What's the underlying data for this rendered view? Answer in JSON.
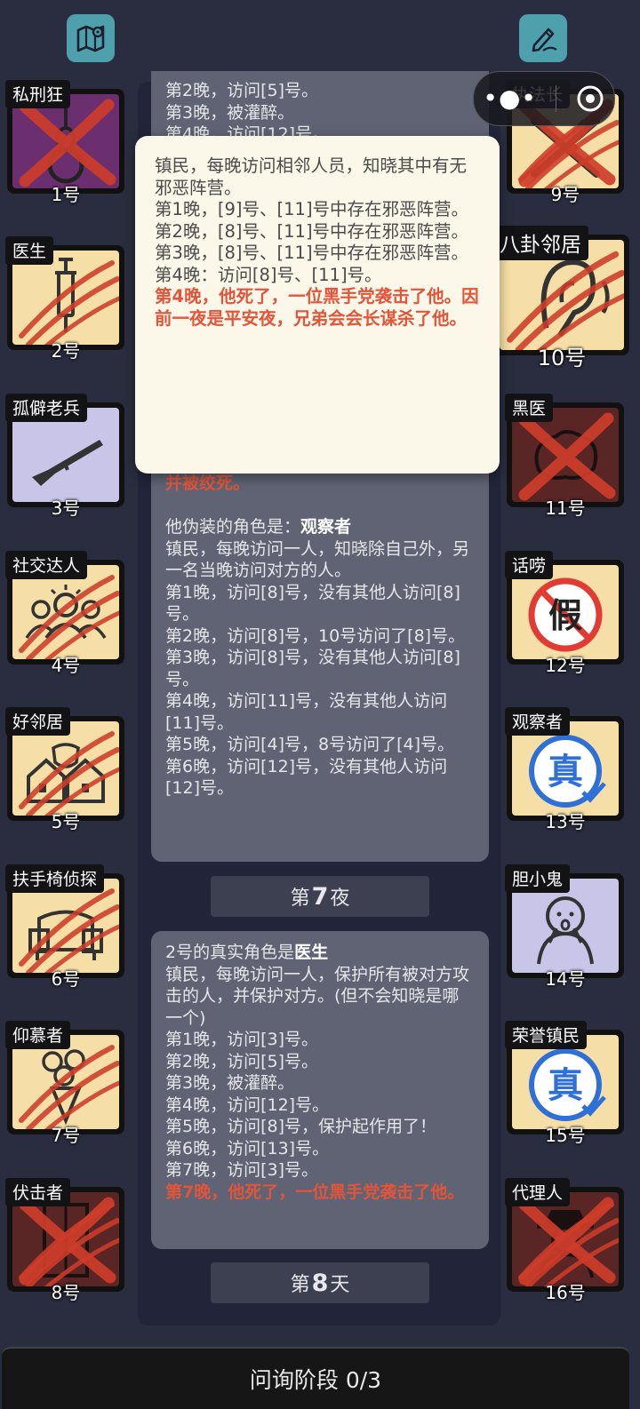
{
  "top_icons": {
    "map": "map-icon",
    "notes": "pencil-icon"
  },
  "players_left": [
    {
      "name": "私刑狂",
      "num": "1号",
      "bg": "darkpurple",
      "dead": true,
      "claw": false,
      "icon": "noose"
    },
    {
      "name": "医生",
      "num": "2号",
      "bg": "yellow",
      "dead": false,
      "claw": true,
      "icon": "syringe"
    },
    {
      "name": "孤僻老兵",
      "num": "3号",
      "bg": "purple",
      "dead": false,
      "claw": false,
      "icon": "rifle"
    },
    {
      "name": "社交达人",
      "num": "4号",
      "bg": "yellow",
      "dead": false,
      "claw": true,
      "icon": "people"
    },
    {
      "name": "好邻居",
      "num": "5号",
      "bg": "yellow",
      "dead": false,
      "claw": true,
      "icon": "houses"
    },
    {
      "name": "扶手椅侦探",
      "num": "6号",
      "bg": "yellow",
      "dead": false,
      "claw": true,
      "icon": "armchair"
    },
    {
      "name": "仰慕者",
      "num": "7号",
      "bg": "yellow",
      "dead": false,
      "claw": true,
      "icon": "bouquet"
    },
    {
      "name": "伏击者",
      "num": "8号",
      "bg": "darkred",
      "dead": true,
      "claw": true,
      "icon": "door"
    }
  ],
  "players_right": [
    {
      "name": "执法长",
      "num": "9号",
      "bg": "yellow",
      "dead": true,
      "claw": true,
      "icon": "batons"
    },
    {
      "name": "八卦邻居",
      "num": "10号",
      "bg": "yellow",
      "dead": false,
      "claw": true,
      "icon": "ear"
    },
    {
      "name": "黑医",
      "num": "11号",
      "bg": "darkred",
      "dead": true,
      "claw": false,
      "icon": "brain"
    },
    {
      "name": "话唠",
      "num": "12号",
      "bg": "yellow",
      "dead": false,
      "claw": false,
      "icon": "fake"
    },
    {
      "name": "观察者",
      "num": "13号",
      "bg": "yellow",
      "dead": false,
      "claw": false,
      "icon": "real"
    },
    {
      "name": "胆小鬼",
      "num": "14号",
      "bg": "purple",
      "dead": false,
      "claw": false,
      "icon": "scared"
    },
    {
      "name": "荣誉镇民",
      "num": "15号",
      "bg": "yellow",
      "dead": false,
      "claw": false,
      "icon": "real"
    },
    {
      "name": "代理人",
      "num": "16号",
      "bg": "darkred",
      "dead": true,
      "claw": true,
      "icon": "agent"
    }
  ],
  "log_top": [
    {
      "t": "第2晚，访问[5]号。"
    },
    {
      "t": "第3晚，被灌醉。"
    },
    {
      "t": "第4晚，访问[12]号。"
    }
  ],
  "log_card1": [
    {
      "t": "并被绞死。",
      "red": true
    },
    {
      "t": " "
    },
    {
      "t": "他伪装的角色是：",
      "b": "观察者"
    },
    {
      "t": "镇民，每晚访问一人，知晓除自己外，另一名当晚访问对方的人。"
    },
    {
      "t": "第1晚，访问[8]号，没有其他人访问[8]号。"
    },
    {
      "t": "第2晚，访问[8]号，10号访问了[8]号。"
    },
    {
      "t": "第3晚，访问[8]号，没有其他人访问[8]号。"
    },
    {
      "t": "第4晚，访问[11]号，没有其他人访问[11]号。"
    },
    {
      "t": "第5晚，访问[4]号，8号访问了[4]号。"
    },
    {
      "t": "第6晚，访问[12]号，没有其他人访问[12]号。"
    }
  ],
  "night7": {
    "prefix": "第",
    "num": "7",
    "suffix": "夜"
  },
  "log_card2": [
    {
      "t": "2号的真实角色是",
      "b": "医生"
    },
    {
      "t": "镇民，每晚访问一人，保护所有被对方攻击的人，并保护对方。(但不会知晓是哪一个)"
    },
    {
      "t": "第1晚，访问[3]号。"
    },
    {
      "t": "第2晚，访问[5]号。"
    },
    {
      "t": "第3晚，被灌醉。"
    },
    {
      "t": "第4晚，访问[12]号。"
    },
    {
      "t": "第5晚，访问[8]号，保护起作用了！"
    },
    {
      "t": "第6晚，访问[13]号。"
    },
    {
      "t": "第7晚，访问[3]号。"
    },
    {
      "t": "第7晚，他死了，一位黑手党袭击了他。",
      "red": true
    }
  ],
  "day8": {
    "prefix": "第",
    "num": "8",
    "suffix": "天"
  },
  "tooltip": [
    {
      "t": "镇民，每晚访问相邻人员，知晓其中有无邪恶阵营。"
    },
    {
      "t": "第1晚，[9]号、[11]号中存在邪恶阵营。"
    },
    {
      "t": "第2晚，[8]号、[11]号中存在邪恶阵营。"
    },
    {
      "t": "第3晚，[8]号、[11]号中存在邪恶阵营。"
    },
    {
      "t": "第4晚：访问[8]号、[11]号。"
    },
    {
      "t": "第4晚，他死了，一位黑手党袭击了他。因前一夜是平安夜，兄弟会会长谋杀了他。",
      "red": true
    }
  ],
  "bottom_bar": "问询阶段 0/3"
}
